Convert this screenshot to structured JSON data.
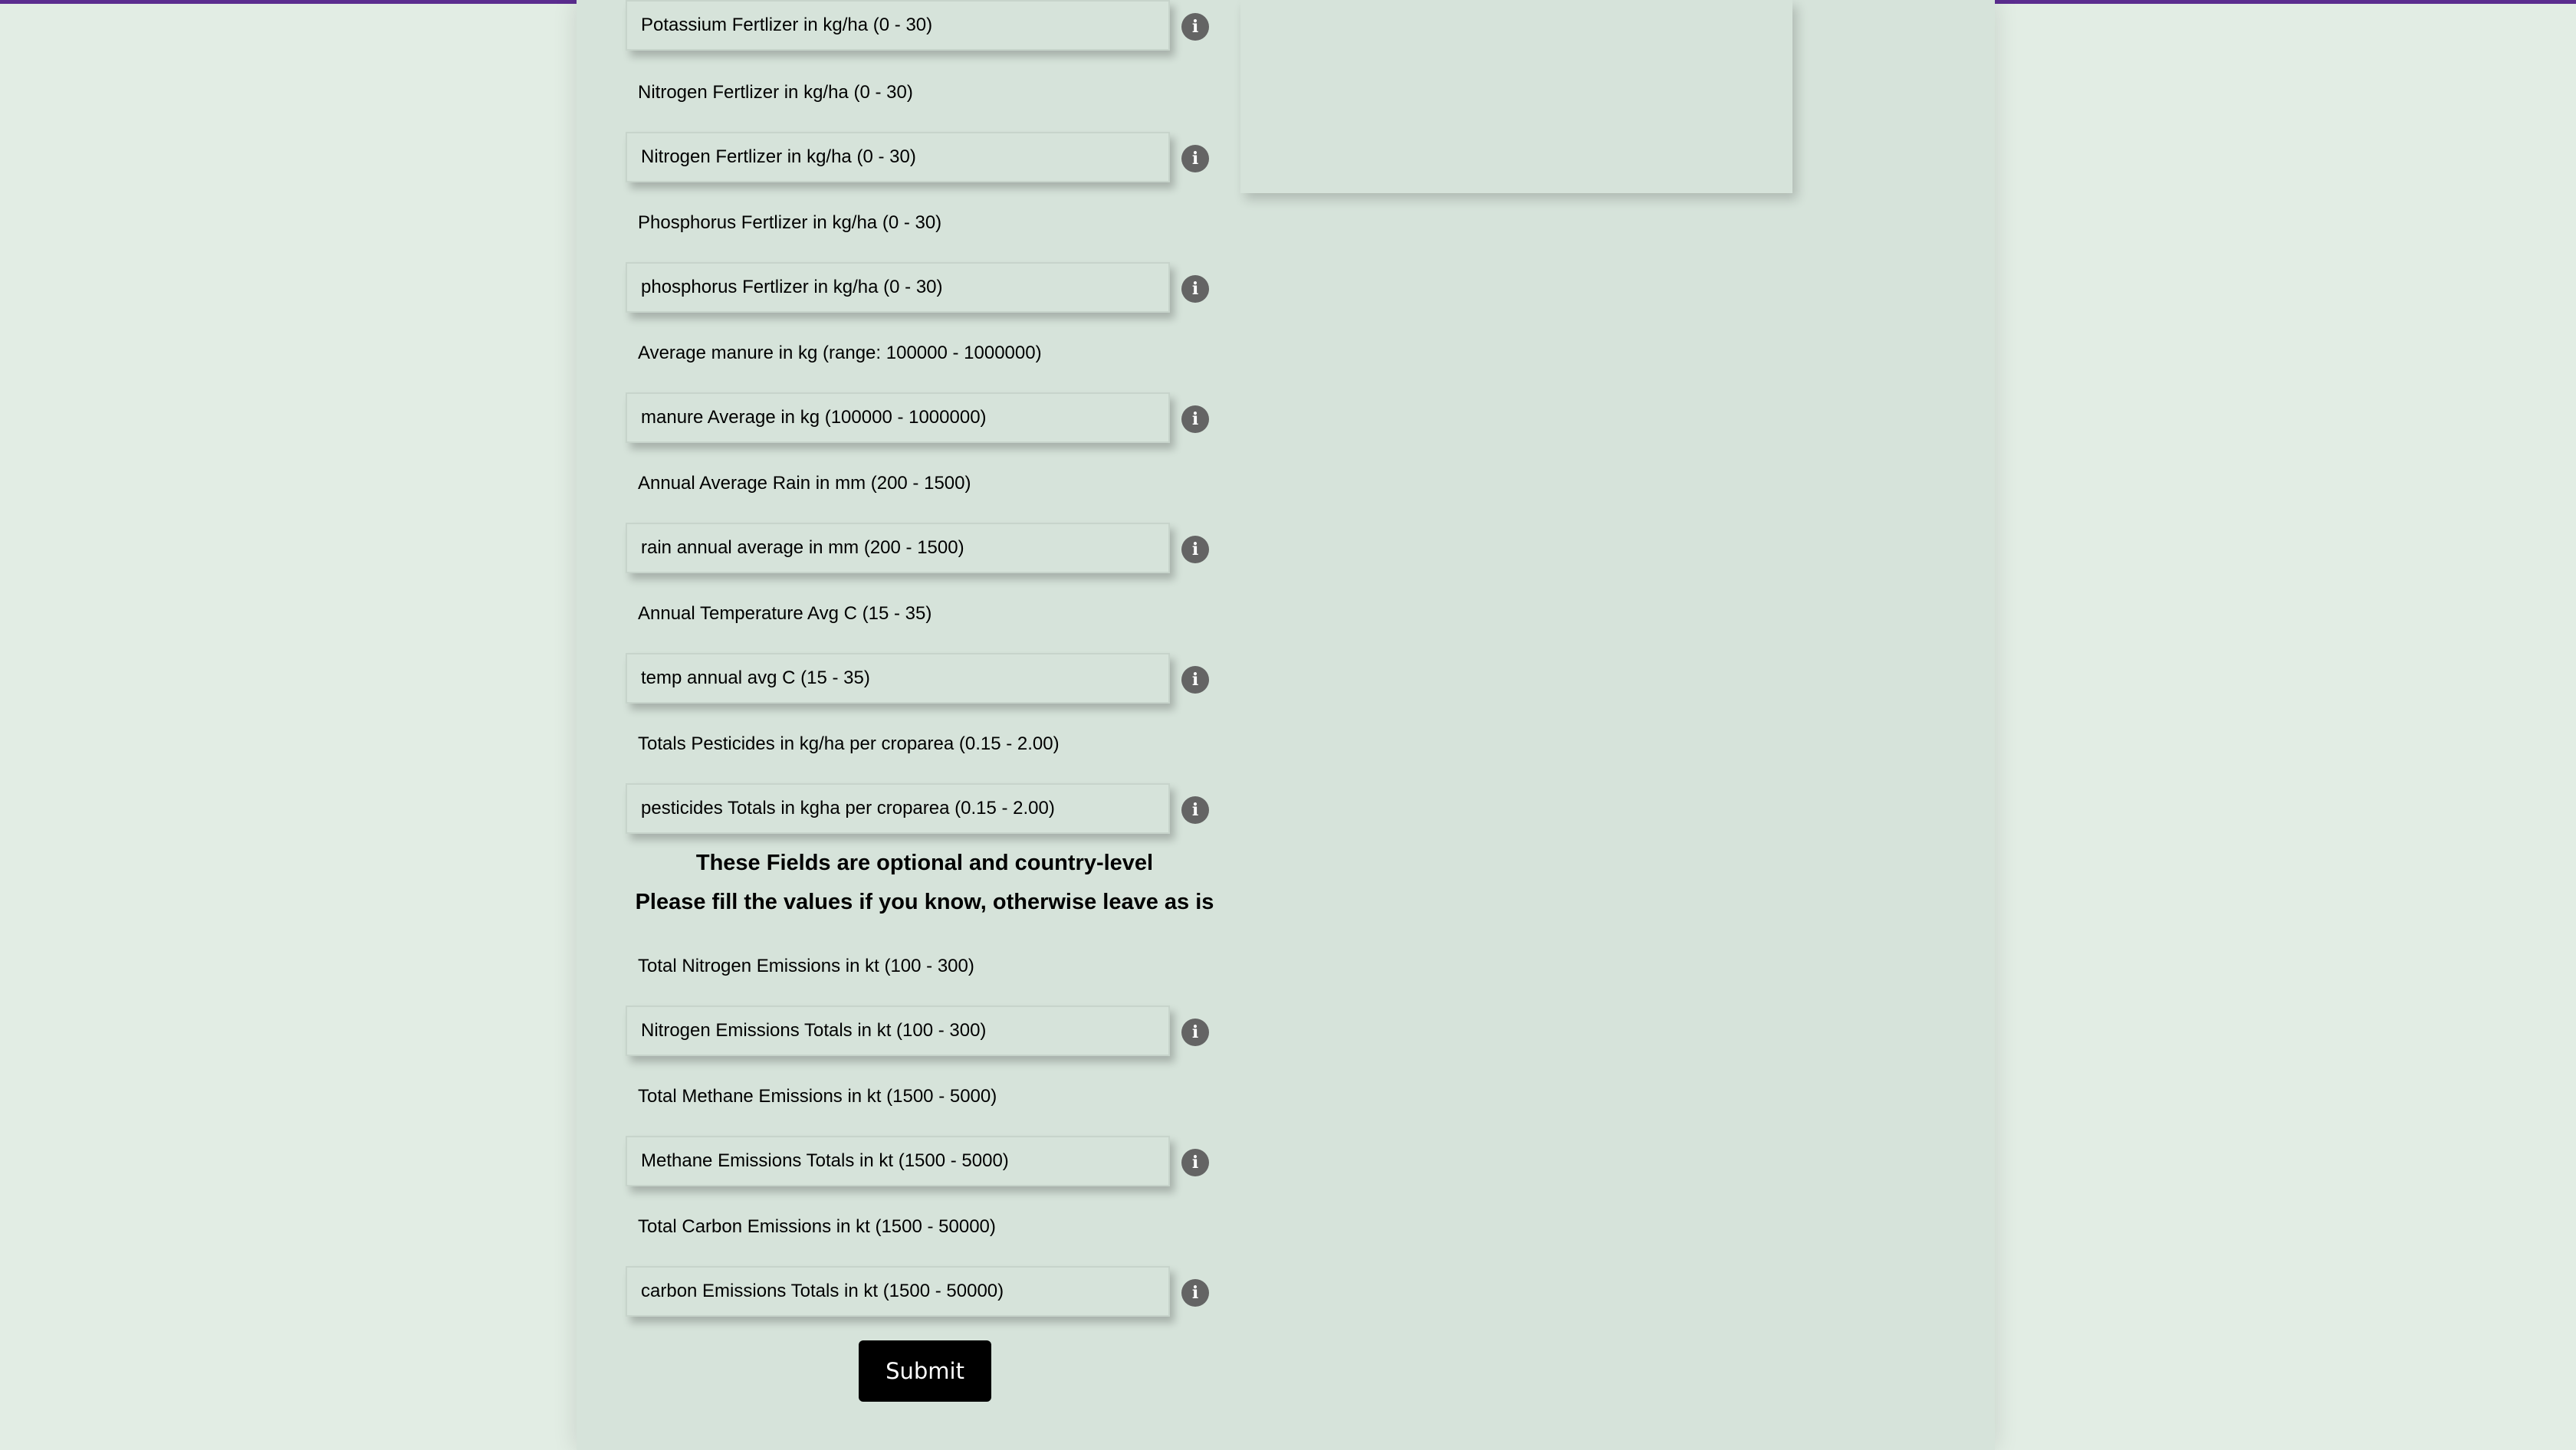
{
  "form": {
    "fields": [
      {
        "label": "",
        "placeholder": "Potassium Fertlizer in kg/ha (0 - 30)",
        "info_icon": "info-icon"
      },
      {
        "label": "Nitrogen Fertlizer in kg/ha (0 - 30)",
        "placeholder": "Nitrogen Fertlizer in kg/ha (0 - 30)",
        "info_icon": "info-icon"
      },
      {
        "label": "Phosphorus Fertlizer in kg/ha (0 - 30)",
        "placeholder": "phosphorus Fertlizer in kg/ha (0 - 30)",
        "info_icon": "info-icon"
      },
      {
        "label": "Average manure in kg (range: 100000 - 1000000)",
        "placeholder": "manure Average in kg (100000 - 1000000)",
        "info_icon": "info-icon"
      },
      {
        "label": "Annual Average Rain in mm (200 - 1500)",
        "placeholder": "rain annual average in mm (200 - 1500)",
        "info_icon": "info-icon"
      },
      {
        "label": "Annual Temperature Avg C (15 - 35)",
        "placeholder": "temp annual avg C (15 - 35)",
        "info_icon": "info-icon"
      },
      {
        "label": "Totals Pesticides in kg/ha per croparea (0.15 - 2.00)",
        "placeholder": "pesticides Totals in kgha per croparea (0.15 - 2.00)",
        "info_icon": "info-icon"
      }
    ],
    "optional_notice": {
      "line1": "These Fields are optional and country-level",
      "line2": "Please fill the values if you know, otherwise leave as is"
    },
    "optional_fields": [
      {
        "label": "Total Nitrogen Emissions in kt (100 - 300)",
        "placeholder": "Nitrogen Emissions Totals in kt (100 - 300)",
        "info_icon": "info-icon"
      },
      {
        "label": "Total Methane Emissions in kt (1500 - 5000)",
        "placeholder": "Methane Emissions Totals in kt (1500 - 5000)",
        "info_icon": "info-icon"
      },
      {
        "label": "Total Carbon Emissions in kt (1500 - 50000)",
        "placeholder": "carbon Emissions Totals in kt (1500 - 50000)",
        "info_icon": "info-icon"
      }
    ],
    "submit_label": "Submit",
    "info_glyph": "i"
  },
  "colors": {
    "page_background": "#e2ede4",
    "panel_background": "#d6e3da",
    "top_bar": "#5b2d8f",
    "info_icon": "#646464",
    "submit_button": "#000000"
  }
}
